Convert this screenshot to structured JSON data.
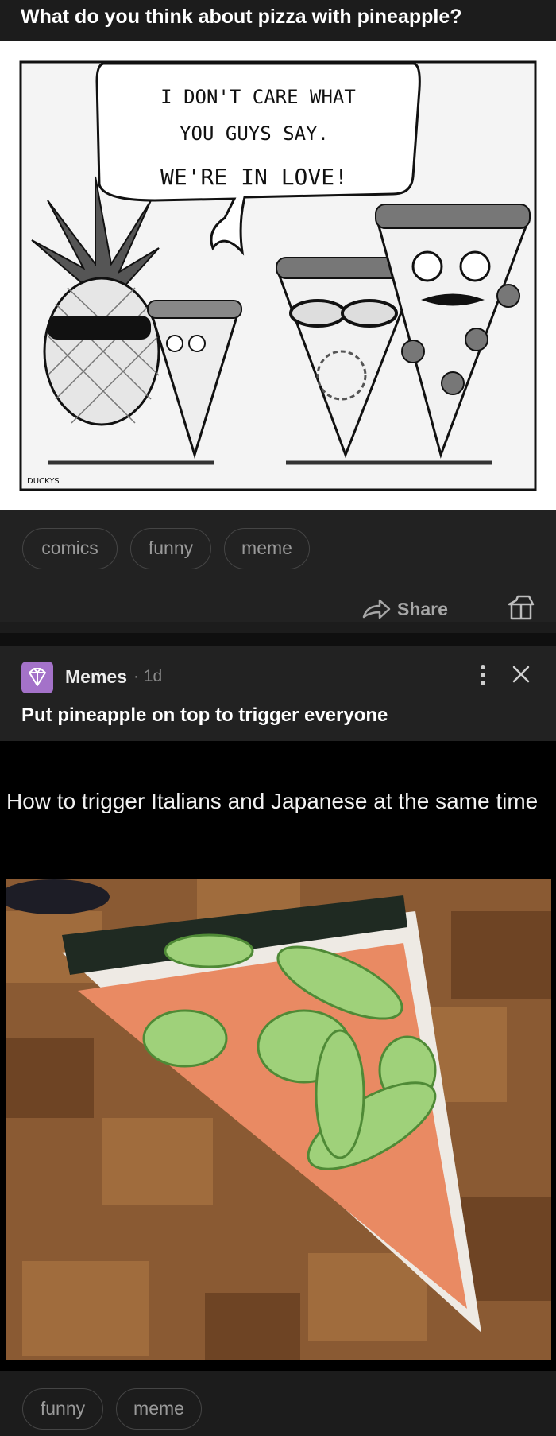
{
  "post1": {
    "title": "What do you think about pizza with pineapple?",
    "comic": {
      "speech": [
        "I DON'T CARE WHAT",
        "YOU GUYS SAY.",
        "WE'RE IN LOVE!"
      ],
      "signature": "DUCKYS"
    },
    "tags": [
      "comics",
      "funny",
      "meme"
    ],
    "share_label": "Share"
  },
  "post2": {
    "subreddit": "Memes",
    "age": "· 1d",
    "title": "Put pineapple on top to trigger everyone",
    "meme_caption": "How to trigger Italians and Japanese at the same time",
    "tags": [
      "funny",
      "meme"
    ]
  },
  "icons": {
    "share": "share-arrow-icon",
    "award": "award-icon",
    "more": "kebab-menu-icon",
    "close": "close-icon",
    "subreddit": "diamond-icon"
  },
  "colors": {
    "background": "#1c1c1c",
    "chip_border": "#454545",
    "avatar": "#a472c9"
  }
}
